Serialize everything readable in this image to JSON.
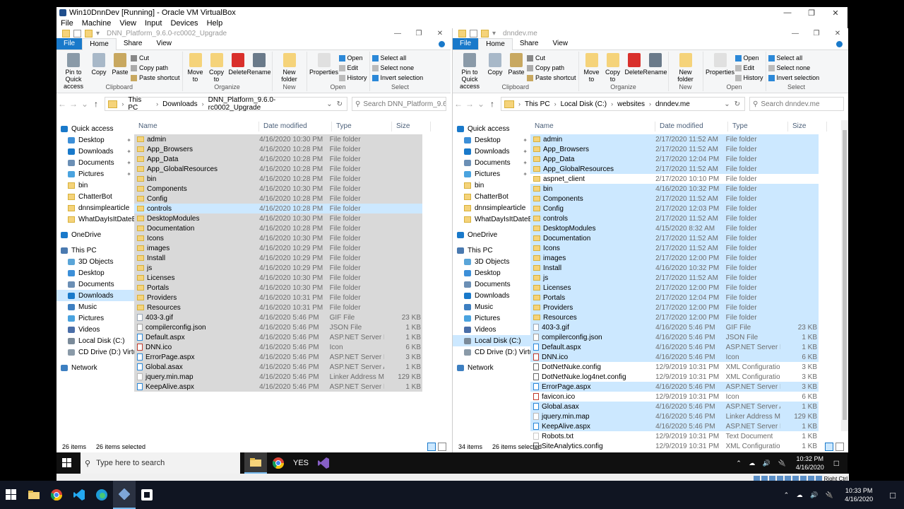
{
  "host_window": {
    "title": "Win10DnnDev [Running] - Oracle VM VirtualBox",
    "menu": [
      "File",
      "Machine",
      "View",
      "Input",
      "Devices",
      "Help"
    ],
    "controls": [
      "—",
      "❐",
      "✕"
    ]
  },
  "ribbon": {
    "tabs": [
      "File",
      "Home",
      "Share",
      "View"
    ],
    "groups": {
      "clipboard": "Clipboard",
      "organize": "Organize",
      "new": "New",
      "open": "Open",
      "select": "Select"
    },
    "pin": "Pin to Quick access",
    "copy": "Copy",
    "paste": "Paste",
    "cut": "Cut",
    "copy_path": "Copy path",
    "paste_shortcut": "Paste shortcut",
    "move_to": "Move to",
    "copy_to": "Copy to",
    "delete": "Delete",
    "rename": "Rename",
    "new_folder": "New folder",
    "properties": "Properties",
    "open_btn": "Open",
    "edit": "Edit",
    "history": "History",
    "select_all": "Select all",
    "select_none": "Select none",
    "invert_selection": "Invert selection"
  },
  "columns": {
    "name": "Name",
    "date": "Date modified",
    "type": "Type",
    "size": "Size"
  },
  "left": {
    "title": "DNN_Platform_9.6.0-rc0002_Upgrade",
    "path": [
      "This PC",
      "Downloads",
      "DNN_Platform_9.6.0-rc0002_Upgrade"
    ],
    "search_placeholder": "Search DNN_Platform_9.6.0-...",
    "nav": [
      {
        "label": "Quick access",
        "icon": "star-icon",
        "pin": ""
      },
      {
        "label": "Desktop",
        "icon": "desktop-icon",
        "pin": "📌"
      },
      {
        "label": "Downloads",
        "icon": "download-icon",
        "pin": "📌"
      },
      {
        "label": "Documents",
        "icon": "documents-icon",
        "pin": "📌"
      },
      {
        "label": "Pictures",
        "icon": "pictures-icon",
        "pin": "📌"
      },
      {
        "label": "bin",
        "icon": "folder-icon",
        "pin": ""
      },
      {
        "label": "ChatterBot",
        "icon": "folder-icon",
        "pin": ""
      },
      {
        "label": "dnnsimplearticle",
        "icon": "folder-icon",
        "pin": ""
      },
      {
        "label": "WhatDayIsItDateBot",
        "icon": "folder-icon",
        "pin": ""
      },
      {
        "label": "OneDrive",
        "icon": "cloud-icon",
        "pin": ""
      },
      {
        "label": "This PC",
        "icon": "pc-icon",
        "pin": ""
      },
      {
        "label": "3D Objects",
        "icon": "cube-icon",
        "pin": ""
      },
      {
        "label": "Desktop",
        "icon": "desktop-icon",
        "pin": ""
      },
      {
        "label": "Documents",
        "icon": "documents-icon",
        "pin": ""
      },
      {
        "label": "Downloads",
        "icon": "download-icon",
        "pin": ""
      },
      {
        "label": "Music",
        "icon": "music-icon",
        "pin": ""
      },
      {
        "label": "Pictures",
        "icon": "pictures-icon",
        "pin": ""
      },
      {
        "label": "Videos",
        "icon": "video-icon",
        "pin": ""
      },
      {
        "label": "Local Disk (C:)",
        "icon": "disk-icon",
        "pin": ""
      },
      {
        "label": "CD Drive (D:) Virtua",
        "icon": "cd-icon",
        "pin": ""
      },
      {
        "label": "Network",
        "icon": "network-icon",
        "pin": ""
      }
    ],
    "nav_selected": 14,
    "files": [
      {
        "name": "admin",
        "date": "4/16/2020 10:30 PM",
        "type": "File folder",
        "size": "",
        "icon": "folder-icon"
      },
      {
        "name": "App_Browsers",
        "date": "4/16/2020 10:28 PM",
        "type": "File folder",
        "size": "",
        "icon": "folder-icon"
      },
      {
        "name": "App_Data",
        "date": "4/16/2020 10:28 PM",
        "type": "File folder",
        "size": "",
        "icon": "folder-icon"
      },
      {
        "name": "App_GlobalResources",
        "date": "4/16/2020 10:28 PM",
        "type": "File folder",
        "size": "",
        "icon": "folder-icon"
      },
      {
        "name": "bin",
        "date": "4/16/2020 10:28 PM",
        "type": "File folder",
        "size": "",
        "icon": "folder-icon"
      },
      {
        "name": "Components",
        "date": "4/16/2020 10:30 PM",
        "type": "File folder",
        "size": "",
        "icon": "folder-icon"
      },
      {
        "name": "Config",
        "date": "4/16/2020 10:28 PM",
        "type": "File folder",
        "size": "",
        "icon": "folder-icon"
      },
      {
        "name": "controls",
        "date": "4/16/2020 10:28 PM",
        "type": "File folder",
        "size": "",
        "icon": "folder-icon"
      },
      {
        "name": "DesktopModules",
        "date": "4/16/2020 10:30 PM",
        "type": "File folder",
        "size": "",
        "icon": "folder-icon"
      },
      {
        "name": "Documentation",
        "date": "4/16/2020 10:28 PM",
        "type": "File folder",
        "size": "",
        "icon": "folder-icon"
      },
      {
        "name": "Icons",
        "date": "4/16/2020 10:30 PM",
        "type": "File folder",
        "size": "",
        "icon": "folder-icon"
      },
      {
        "name": "images",
        "date": "4/16/2020 10:29 PM",
        "type": "File folder",
        "size": "",
        "icon": "folder-icon"
      },
      {
        "name": "Install",
        "date": "4/16/2020 10:29 PM",
        "type": "File folder",
        "size": "",
        "icon": "folder-icon"
      },
      {
        "name": "js",
        "date": "4/16/2020 10:29 PM",
        "type": "File folder",
        "size": "",
        "icon": "folder-icon"
      },
      {
        "name": "Licenses",
        "date": "4/16/2020 10:30 PM",
        "type": "File folder",
        "size": "",
        "icon": "folder-icon"
      },
      {
        "name": "Portals",
        "date": "4/16/2020 10:30 PM",
        "type": "File folder",
        "size": "",
        "icon": "folder-icon"
      },
      {
        "name": "Providers",
        "date": "4/16/2020 10:31 PM",
        "type": "File folder",
        "size": "",
        "icon": "folder-icon"
      },
      {
        "name": "Resources",
        "date": "4/16/2020 10:31 PM",
        "type": "File folder",
        "size": "",
        "icon": "folder-icon"
      },
      {
        "name": "403-3.gif",
        "date": "4/16/2020 5:46 PM",
        "type": "GIF File",
        "size": "23 KB",
        "icon": "gif-file-icon"
      },
      {
        "name": "compilerconfig.json",
        "date": "4/16/2020 5:46 PM",
        "type": "JSON File",
        "size": "1 KB",
        "icon": "json-file-icon"
      },
      {
        "name": "Default.aspx",
        "date": "4/16/2020 5:46 PM",
        "type": "ASP.NET Server Pa...",
        "size": "1 KB",
        "icon": "aspx-file-icon"
      },
      {
        "name": "DNN.ico",
        "date": "4/16/2020 5:46 PM",
        "type": "Icon",
        "size": "6 KB",
        "icon": "ico-file-icon"
      },
      {
        "name": "ErrorPage.aspx",
        "date": "4/16/2020 5:46 PM",
        "type": "ASP.NET Server Pa...",
        "size": "3 KB",
        "icon": "aspx-file-icon"
      },
      {
        "name": "Global.asax",
        "date": "4/16/2020 5:46 PM",
        "type": "ASP.NET Server A...",
        "size": "1 KB",
        "icon": "aspx-file-icon"
      },
      {
        "name": "jquery.min.map",
        "date": "4/16/2020 5:46 PM",
        "type": "Linker Address Map",
        "size": "129 KB",
        "icon": "file-icon"
      },
      {
        "name": "KeepAlive.aspx",
        "date": "4/16/2020 5:46 PM",
        "type": "ASP.NET Server Pa...",
        "size": "1 KB",
        "icon": "aspx-file-icon"
      }
    ],
    "selected_all": true,
    "hover_index": 7,
    "status_items": "26 items",
    "status_selected": "26 items selected"
  },
  "right": {
    "title": "dnndev.me",
    "path": [
      "This PC",
      "Local Disk (C:)",
      "websites",
      "dnndev.me"
    ],
    "search_placeholder": "Search dnndev.me",
    "nav": [
      {
        "label": "Quick access",
        "icon": "star-icon",
        "pin": ""
      },
      {
        "label": "Desktop",
        "icon": "desktop-icon",
        "pin": "📌"
      },
      {
        "label": "Downloads",
        "icon": "download-icon",
        "pin": "📌"
      },
      {
        "label": "Documents",
        "icon": "documents-icon",
        "pin": "📌"
      },
      {
        "label": "Pictures",
        "icon": "pictures-icon",
        "pin": "📌"
      },
      {
        "label": "bin",
        "icon": "folder-icon",
        "pin": ""
      },
      {
        "label": "ChatterBot",
        "icon": "folder-icon",
        "pin": ""
      },
      {
        "label": "dnnsimplearticle",
        "icon": "folder-icon",
        "pin": ""
      },
      {
        "label": "WhatDayIsItDateBot",
        "icon": "folder-icon",
        "pin": ""
      },
      {
        "label": "OneDrive",
        "icon": "cloud-icon",
        "pin": ""
      },
      {
        "label": "This PC",
        "icon": "pc-icon",
        "pin": ""
      },
      {
        "label": "3D Objects",
        "icon": "cube-icon",
        "pin": ""
      },
      {
        "label": "Desktop",
        "icon": "desktop-icon",
        "pin": ""
      },
      {
        "label": "Documents",
        "icon": "documents-icon",
        "pin": ""
      },
      {
        "label": "Downloads",
        "icon": "download-icon",
        "pin": ""
      },
      {
        "label": "Music",
        "icon": "music-icon",
        "pin": ""
      },
      {
        "label": "Pictures",
        "icon": "pictures-icon",
        "pin": ""
      },
      {
        "label": "Videos",
        "icon": "video-icon",
        "pin": ""
      },
      {
        "label": "Local Disk (C:)",
        "icon": "disk-icon",
        "pin": ""
      },
      {
        "label": "CD Drive (D:) Virtua",
        "icon": "cd-icon",
        "pin": ""
      },
      {
        "label": "Network",
        "icon": "network-icon",
        "pin": ""
      }
    ],
    "nav_selected": 18,
    "files": [
      {
        "name": "admin",
        "date": "2/17/2020 11:52 AM",
        "type": "File folder",
        "size": "",
        "icon": "folder-icon",
        "sel": true
      },
      {
        "name": "App_Browsers",
        "date": "2/17/2020 11:52 AM",
        "type": "File folder",
        "size": "",
        "icon": "folder-icon",
        "sel": true
      },
      {
        "name": "App_Data",
        "date": "2/17/2020 12:04 PM",
        "type": "File folder",
        "size": "",
        "icon": "folder-icon",
        "sel": true
      },
      {
        "name": "App_GlobalResources",
        "date": "2/17/2020 11:52 AM",
        "type": "File folder",
        "size": "",
        "icon": "folder-icon",
        "sel": true
      },
      {
        "name": "aspnet_client",
        "date": "2/17/2020 10:10 PM",
        "type": "File folder",
        "size": "",
        "icon": "folder-icon",
        "sel": false
      },
      {
        "name": "bin",
        "date": "4/16/2020 10:32 PM",
        "type": "File folder",
        "size": "",
        "icon": "folder-icon",
        "sel": true
      },
      {
        "name": "Components",
        "date": "2/17/2020 11:52 AM",
        "type": "File folder",
        "size": "",
        "icon": "folder-icon",
        "sel": true
      },
      {
        "name": "Config",
        "date": "2/17/2020 12:03 PM",
        "type": "File folder",
        "size": "",
        "icon": "folder-icon",
        "sel": true
      },
      {
        "name": "controls",
        "date": "2/17/2020 11:52 AM",
        "type": "File folder",
        "size": "",
        "icon": "folder-icon",
        "sel": true
      },
      {
        "name": "DesktopModules",
        "date": "4/15/2020 8:32 AM",
        "type": "File folder",
        "size": "",
        "icon": "folder-icon",
        "sel": true
      },
      {
        "name": "Documentation",
        "date": "2/17/2020 11:52 AM",
        "type": "File folder",
        "size": "",
        "icon": "folder-icon",
        "sel": true
      },
      {
        "name": "Icons",
        "date": "2/17/2020 11:52 AM",
        "type": "File folder",
        "size": "",
        "icon": "folder-icon",
        "sel": true
      },
      {
        "name": "images",
        "date": "2/17/2020 12:00 PM",
        "type": "File folder",
        "size": "",
        "icon": "folder-icon",
        "sel": true
      },
      {
        "name": "Install",
        "date": "4/16/2020 10:32 PM",
        "type": "File folder",
        "size": "",
        "icon": "folder-icon",
        "sel": true
      },
      {
        "name": "js",
        "date": "2/17/2020 11:52 AM",
        "type": "File folder",
        "size": "",
        "icon": "folder-icon",
        "sel": true
      },
      {
        "name": "Licenses",
        "date": "2/17/2020 12:00 PM",
        "type": "File folder",
        "size": "",
        "icon": "folder-icon",
        "sel": true
      },
      {
        "name": "Portals",
        "date": "2/17/2020 12:04 PM",
        "type": "File folder",
        "size": "",
        "icon": "folder-icon",
        "sel": true
      },
      {
        "name": "Providers",
        "date": "2/17/2020 12:00 PM",
        "type": "File folder",
        "size": "",
        "icon": "folder-icon",
        "sel": true
      },
      {
        "name": "Resources",
        "date": "2/17/2020 12:00 PM",
        "type": "File folder",
        "size": "",
        "icon": "folder-icon",
        "sel": true
      },
      {
        "name": "403-3.gif",
        "date": "4/16/2020 5:46 PM",
        "type": "GIF File",
        "size": "23 KB",
        "icon": "gif-file-icon",
        "sel": true
      },
      {
        "name": "compilerconfig.json",
        "date": "4/16/2020 5:46 PM",
        "type": "JSON File",
        "size": "1 KB",
        "icon": "json-file-icon",
        "sel": true
      },
      {
        "name": "Default.aspx",
        "date": "4/16/2020 5:46 PM",
        "type": "ASP.NET Server Pa...",
        "size": "1 KB",
        "icon": "aspx-file-icon",
        "sel": true
      },
      {
        "name": "DNN.ico",
        "date": "4/16/2020 5:46 PM",
        "type": "Icon",
        "size": "6 KB",
        "icon": "ico-file-icon",
        "sel": true
      },
      {
        "name": "DotNetNuke.config",
        "date": "12/9/2019 10:31 PM",
        "type": "XML Configuratio...",
        "size": "3 KB",
        "icon": "config-file-icon",
        "sel": false
      },
      {
        "name": "DotNetNuke.log4net.config",
        "date": "12/9/2019 10:31 PM",
        "type": "XML Configuratio...",
        "size": "3 KB",
        "icon": "config-file-icon",
        "sel": false
      },
      {
        "name": "ErrorPage.aspx",
        "date": "4/16/2020 5:46 PM",
        "type": "ASP.NET Server Pa...",
        "size": "3 KB",
        "icon": "aspx-file-icon",
        "sel": true
      },
      {
        "name": "favicon.ico",
        "date": "12/9/2019 10:31 PM",
        "type": "Icon",
        "size": "6 KB",
        "icon": "ico-file-icon",
        "sel": false
      },
      {
        "name": "Global.asax",
        "date": "4/16/2020 5:46 PM",
        "type": "ASP.NET Server A...",
        "size": "1 KB",
        "icon": "aspx-file-icon",
        "sel": true
      },
      {
        "name": "jquery.min.map",
        "date": "4/16/2020 5:46 PM",
        "type": "Linker Address Map",
        "size": "129 KB",
        "icon": "file-icon",
        "sel": true
      },
      {
        "name": "KeepAlive.aspx",
        "date": "4/16/2020 5:46 PM",
        "type": "ASP.NET Server Pa...",
        "size": "1 KB",
        "icon": "aspx-file-icon",
        "sel": true
      },
      {
        "name": "Robots.txt",
        "date": "12/9/2019 10:31 PM",
        "type": "Text Document",
        "size": "1 KB",
        "icon": "text-file-icon",
        "sel": false
      },
      {
        "name": "SiteAnalytics.config",
        "date": "12/9/2019 10:31 PM",
        "type": "XML Configuratio...",
        "size": "1 KB",
        "icon": "config-file-icon",
        "sel": false
      }
    ],
    "status_items": "34 items",
    "status_selected": "26 items selected"
  },
  "guest_taskbar": {
    "search_placeholder": "Type here to search",
    "apps": [
      {
        "name": "file-explorer-icon",
        "glyph": "",
        "active": true
      },
      {
        "name": "chrome-icon",
        "glyph": "",
        "active": false
      },
      {
        "name": "yes-app-icon",
        "glyph": "YES",
        "active": false
      },
      {
        "name": "visual-studio-icon",
        "glyph": "",
        "active": false
      }
    ],
    "time": "10:32 PM",
    "date": "4/16/2020"
  },
  "vbox_status": {
    "host_key": "Right Ctrl"
  },
  "host_taskbar": {
    "time": "10:33 PM",
    "date": "4/16/2020"
  },
  "colors": {
    "accent": "#1979ca",
    "folder": "#f5d37a",
    "selection_blue": "#cce8ff",
    "selection_gray": "#d9d9d9"
  }
}
